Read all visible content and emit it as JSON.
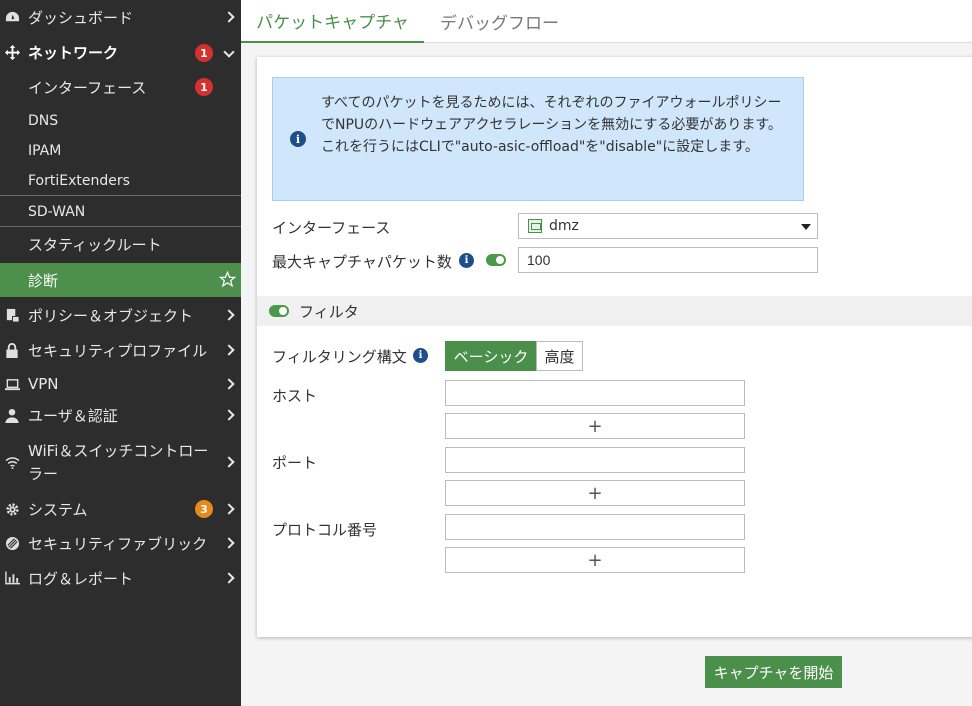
{
  "sidebar": {
    "dashboard": "ダッシュボード",
    "network": "ネットワーク",
    "network_badge": "1",
    "network_items": {
      "interfaces": "インターフェース",
      "interfaces_badge": "1",
      "dns": "DNS",
      "ipam": "IPAM",
      "fortiextenders": "FortiExtenders",
      "sdwan": "SD-WAN",
      "static_routes": "スタティックルート",
      "diagnostics": "診断"
    },
    "policy_objects": "ポリシー＆オブジェクト",
    "security_profiles": "セキュリティプロファイル",
    "vpn": "VPN",
    "user_auth": "ユーザ＆認証",
    "wifi_line1": "WiFi＆スイッチコントロー",
    "wifi_line2": "ラー",
    "system": "システム",
    "system_badge": "3",
    "security_fabric": "セキュリティファブリック",
    "log_report": "ログ＆レポート"
  },
  "tabs": {
    "packet_capture": "パケットキャプチャ",
    "debug_flow": "デバッグフロー"
  },
  "info": {
    "text": "すべてのパケットを見るためには、それぞれのファイアウォールポリシーでNPUのハードウェアアクセラレーションを無効にする必要があります。これを行うにはCLIで\"auto-asic-offload\"を\"disable\"に設定します。"
  },
  "form": {
    "interface_label": "インターフェース",
    "interface_value": "dmz",
    "max_packets_label": "最大キャプチャパケット数",
    "max_packets_value": "100",
    "filter_label": "フィルタ",
    "filter_syntax_label": "フィルタリング構文",
    "syntax_basic": "ベーシック",
    "syntax_advanced": "高度",
    "host_label": "ホスト",
    "port_label": "ポート",
    "protocol_label": "プロトコル番号",
    "host_value": "",
    "port_value": "",
    "protocol_value": "",
    "add_symbol": "+"
  },
  "actions": {
    "start_capture": "キャプチャを開始"
  },
  "colors": {
    "accent": "#4a8f4a",
    "sidebar_bg": "#2d2d2d",
    "badge_red": "#d3302f",
    "badge_orange": "#e8891d",
    "info_bg": "#cfe6fb"
  }
}
